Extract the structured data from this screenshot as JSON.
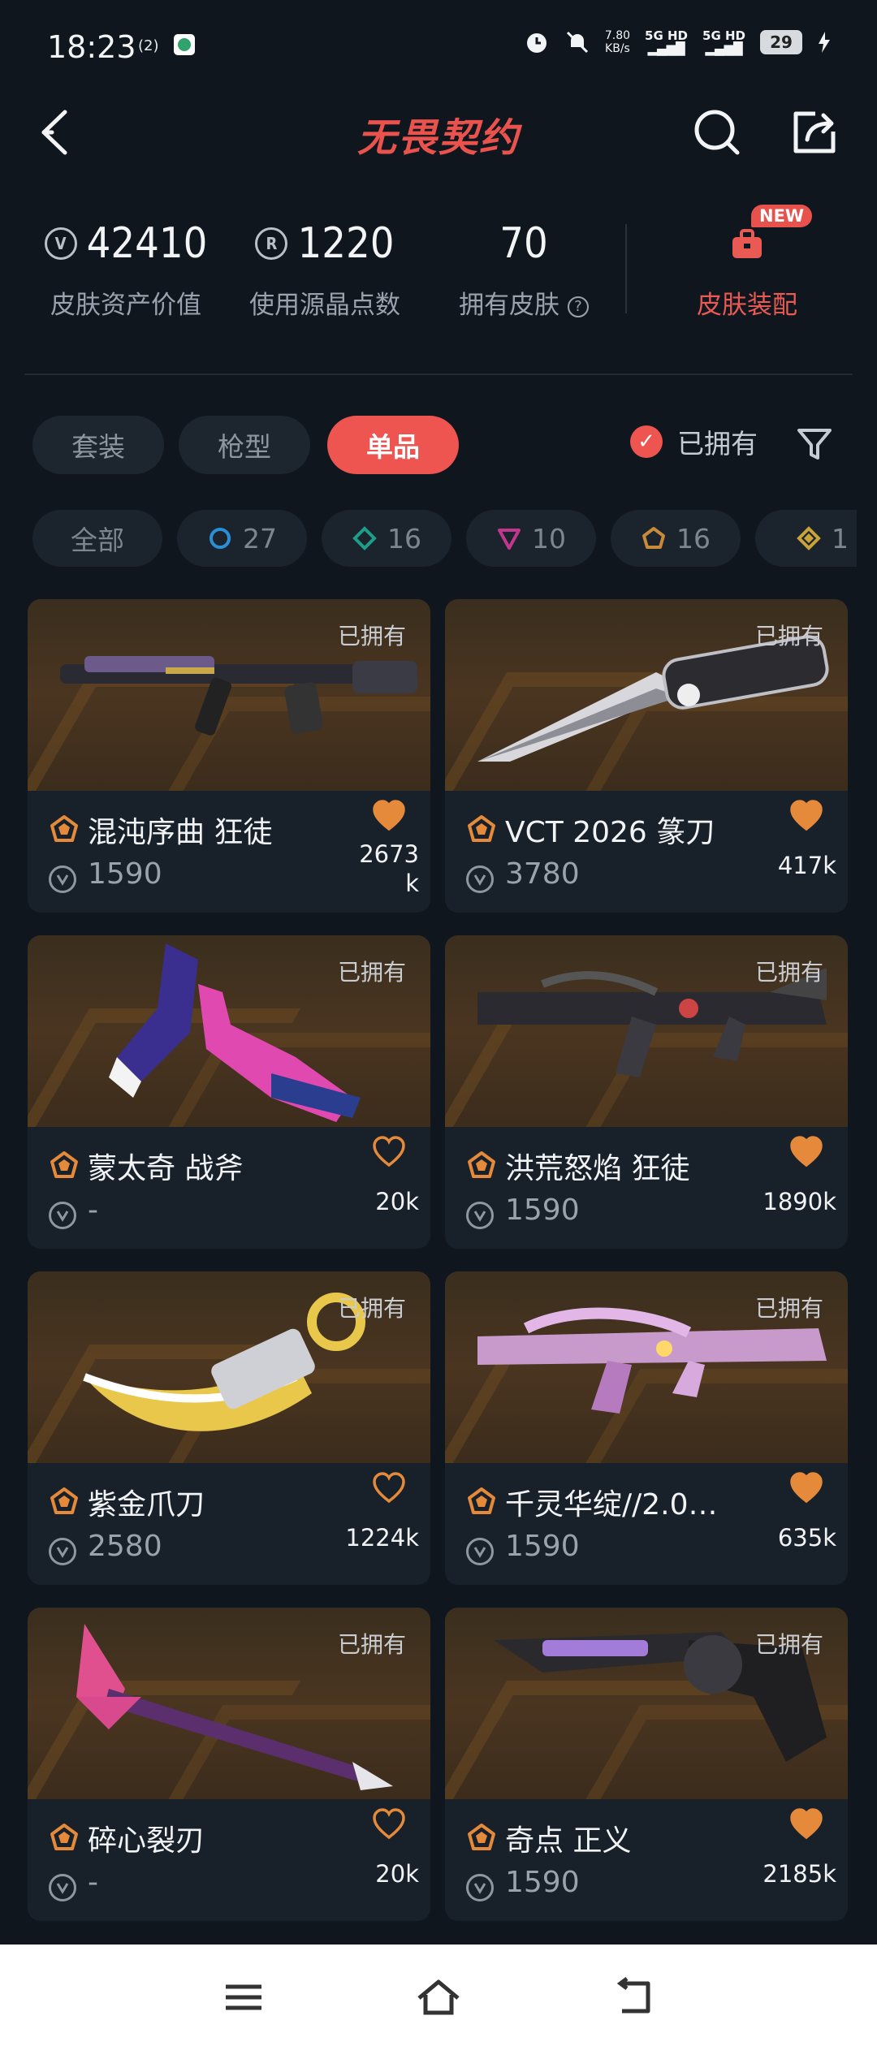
{
  "status_bar": {
    "time": "18:23",
    "netspeed_value": "7.80",
    "netspeed_unit": "KB/s",
    "sim1": "5G HD",
    "sim2": "5G HD",
    "battery": "29"
  },
  "header": {
    "title": "无畏契约",
    "icons": [
      "back-icon",
      "search-icon",
      "share-icon"
    ]
  },
  "stats": {
    "asset_value": "42410",
    "asset_label": "皮肤资产价值",
    "radianite": "1220",
    "radianite_label": "使用源晶点数",
    "owned_count": "70",
    "owned_label": "拥有皮肤",
    "outfit_label": "皮肤装配",
    "new_badge": "NEW"
  },
  "tabs": [
    "套装",
    "枪型",
    "单品"
  ],
  "active_tab": "单品",
  "owned_filter_label": "已拥有",
  "tier_chips": [
    {
      "label": "全部",
      "count": ""
    },
    {
      "label": "",
      "count": "27",
      "color": "#2b8fd6"
    },
    {
      "label": "",
      "count": "16",
      "color": "#1e9e8a"
    },
    {
      "label": "",
      "count": "10",
      "color": "#c3368f"
    },
    {
      "label": "",
      "count": "16",
      "color": "#c98b3a"
    },
    {
      "label": "",
      "count": "1",
      "color": "#c9a33a"
    }
  ],
  "cards": [
    {
      "name": "混沌序曲 狂徒",
      "price": "1590",
      "likes": "2673k",
      "owned": "已拥有",
      "heart_filled": true,
      "accent": "#e58a3a"
    },
    {
      "name": "VCT 2026 篆刀",
      "price": "3780",
      "likes": "417k",
      "owned": "已拥有",
      "heart_filled": true,
      "accent": "#e58a3a"
    },
    {
      "name": "蒙太奇 战斧",
      "price": "-",
      "likes": "20k",
      "owned": "已拥有",
      "heart_filled": false,
      "accent": "#e58a3a"
    },
    {
      "name": "洪荒怒焰 狂徒",
      "price": "1590",
      "likes": "1890k",
      "owned": "已拥有",
      "heart_filled": true,
      "accent": "#e58a3a"
    },
    {
      "name": "紫金爪刀",
      "price": "2580",
      "likes": "1224k",
      "owned": "已拥有",
      "heart_filled": false,
      "accent": "#e58a3a"
    },
    {
      "name": "千灵华绽//2.0…",
      "price": "1590",
      "likes": "635k",
      "owned": "已拥有",
      "heart_filled": true,
      "accent": "#e58a3a"
    },
    {
      "name": "碎心裂刃",
      "price": "-",
      "likes": "20k",
      "owned": "已拥有",
      "heart_filled": false,
      "accent": "#e58a3a"
    },
    {
      "name": "奇点 正义",
      "price": "1590",
      "likes": "2185k",
      "owned": "已拥有",
      "heart_filled": true,
      "accent": "#e58a3a"
    }
  ],
  "nav": [
    "menu-icon",
    "home-icon",
    "back-nav-icon"
  ]
}
